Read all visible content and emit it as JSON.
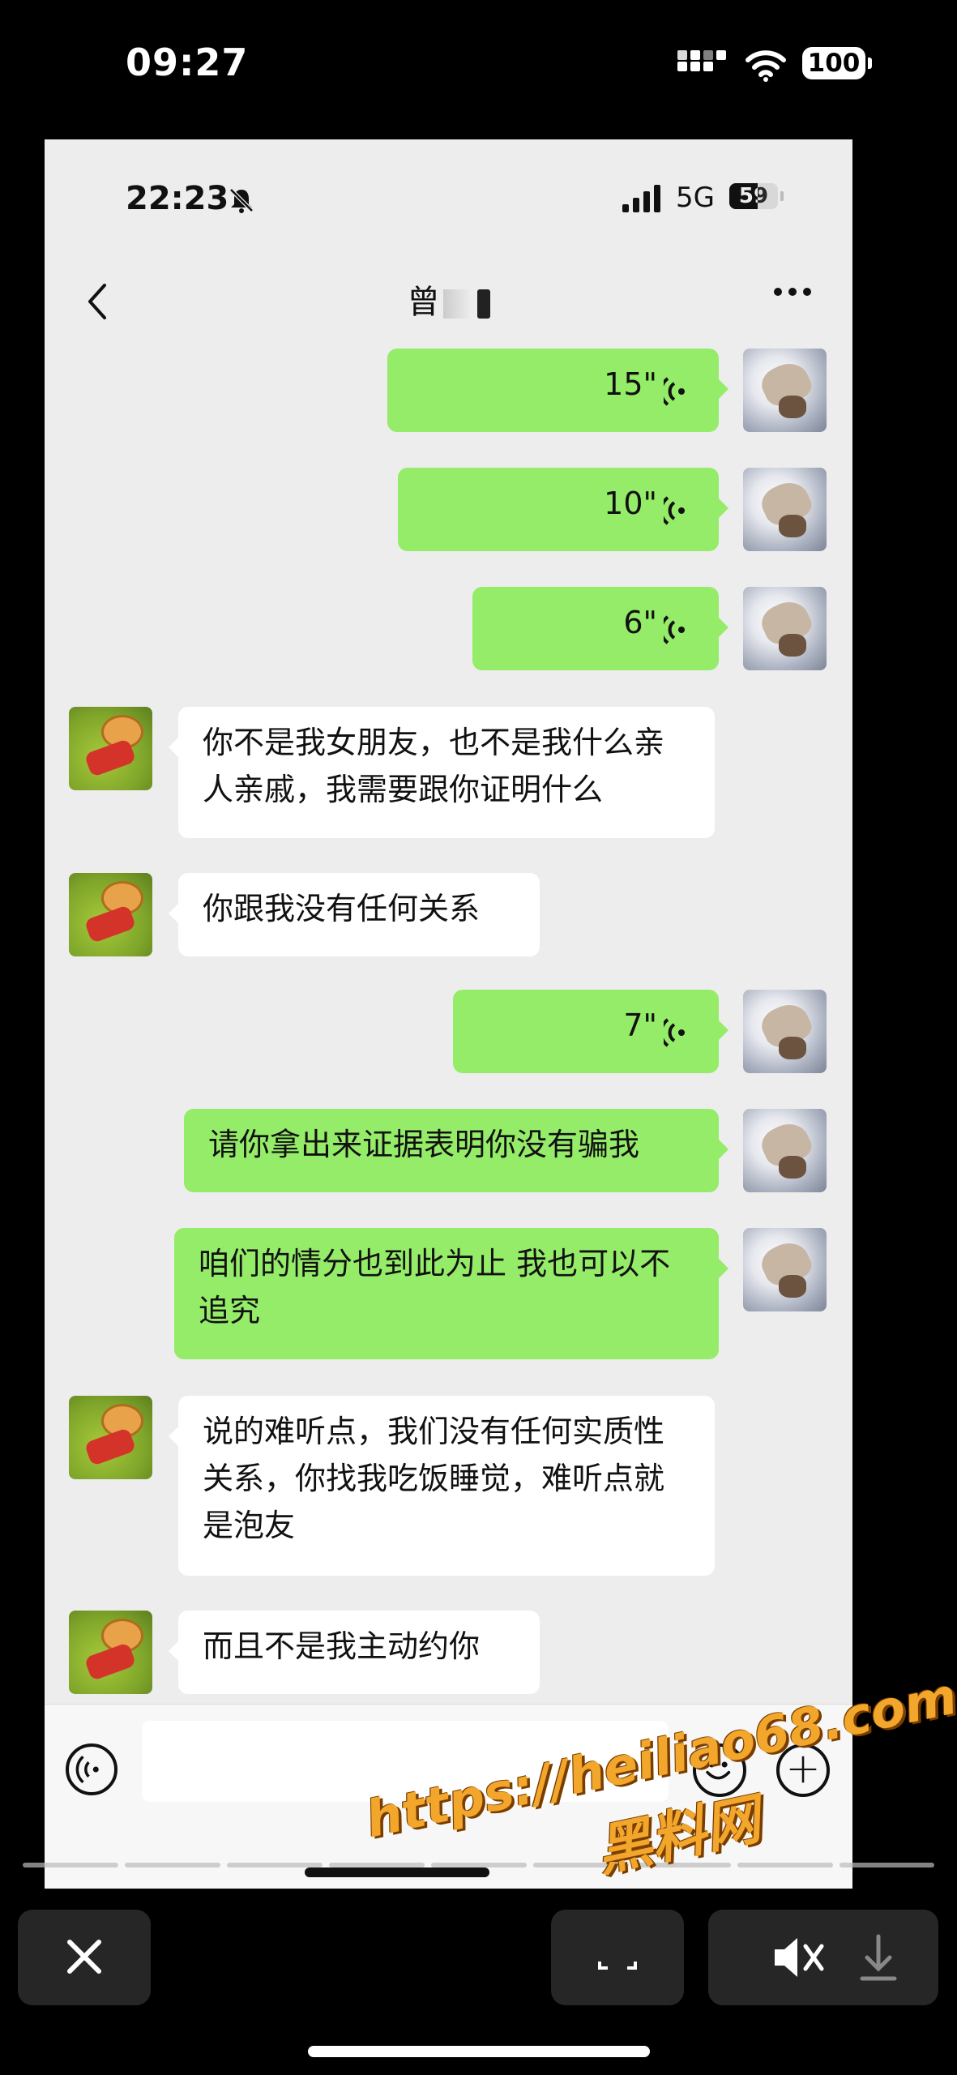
{
  "outer_status": {
    "time": "09:27",
    "battery": "100"
  },
  "inner_status": {
    "time": "22:23",
    "network": "5G",
    "battery": "59"
  },
  "header": {
    "title": "曾"
  },
  "messages": [
    {
      "from": "me",
      "type": "voice",
      "duration": "15\""
    },
    {
      "from": "me",
      "type": "voice",
      "duration": "10\""
    },
    {
      "from": "me",
      "type": "voice",
      "duration": "6\""
    },
    {
      "from": "other",
      "type": "text",
      "text": "你不是我女朋友，也不是我什么亲人亲戚，我需要跟你证明什么"
    },
    {
      "from": "other",
      "type": "text",
      "text": "你跟我没有任何关系"
    },
    {
      "from": "me",
      "type": "voice",
      "duration": "7\""
    },
    {
      "from": "me",
      "type": "text",
      "text": "请你拿出来证据表明你没有骗我"
    },
    {
      "from": "me",
      "type": "text",
      "text": "咱们的情分也到此为止 我也可以不追究"
    },
    {
      "from": "other",
      "type": "text",
      "text": "说的难听点，我们没有任何实质性关系，你找我吃饭睡觉，难听点就是泡友"
    },
    {
      "from": "other",
      "type": "text",
      "text": "而且不是我主动约你"
    }
  ],
  "watermark": {
    "url": "https://heiliao68.com",
    "name": "黑料网"
  },
  "icons": {
    "back": "chevron-left-icon",
    "more": "more-icon",
    "voice_input": "voice-input-icon",
    "emoji": "emoji-icon",
    "plus": "plus-icon",
    "close": "close-icon",
    "mute": "mute-icon",
    "download": "download-icon"
  },
  "colors": {
    "my_bubble": "#95ec69",
    "their_bubble": "#ffffff",
    "chat_bg": "#ededed"
  }
}
